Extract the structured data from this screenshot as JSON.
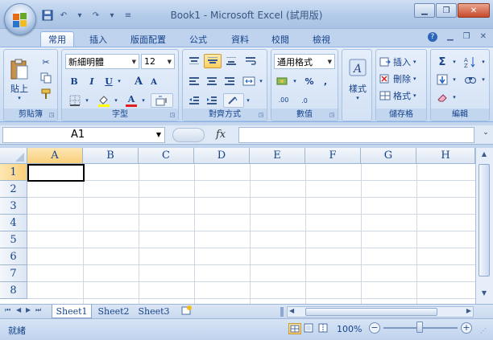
{
  "window": {
    "title": "Book1 - Microsoft Excel (試用版)"
  },
  "tabs": [
    {
      "label": "常用",
      "active": true
    },
    {
      "label": "插入"
    },
    {
      "label": "版面配置"
    },
    {
      "label": "公式"
    },
    {
      "label": "資料"
    },
    {
      "label": "校閱"
    },
    {
      "label": "檢視"
    }
  ],
  "clipboard": {
    "paste_label": "貼上",
    "group_label": "剪貼簿"
  },
  "font": {
    "name": "新細明體",
    "size": "12",
    "group_label": "字型",
    "bold": "B",
    "italic": "I",
    "underline": "U",
    "grow": "A",
    "shrink": "A",
    "color_letter": "A"
  },
  "alignment": {
    "group_label": "對齊方式"
  },
  "number": {
    "format": "通用格式",
    "percent": "%",
    "comma": ",",
    "inc_decimal": ".00",
    "dec_decimal": ".0",
    "group_label": "數值"
  },
  "styles": {
    "label": "樣式"
  },
  "cells": {
    "insert": "插入",
    "delete": "刪除",
    "format": "格式",
    "group_label": "儲存格"
  },
  "editing": {
    "sum": "Σ",
    "group_label": "編輯"
  },
  "formula_bar": {
    "name_box": "A1",
    "fx": "fx"
  },
  "grid": {
    "columns": [
      "A",
      "B",
      "C",
      "D",
      "E",
      "F",
      "G",
      "H"
    ],
    "rows": [
      "1",
      "2",
      "3",
      "4",
      "5",
      "6",
      "7",
      "8"
    ]
  },
  "sheets": [
    {
      "label": "Sheet1",
      "active": true
    },
    {
      "label": "Sheet2"
    },
    {
      "label": "Sheet3"
    }
  ],
  "status": {
    "mode": "就緒",
    "zoom": "100%"
  },
  "colors": {
    "ribbon": "#d4e3f5",
    "accent": "#15428b",
    "grid_line": "#d0d7e5"
  }
}
